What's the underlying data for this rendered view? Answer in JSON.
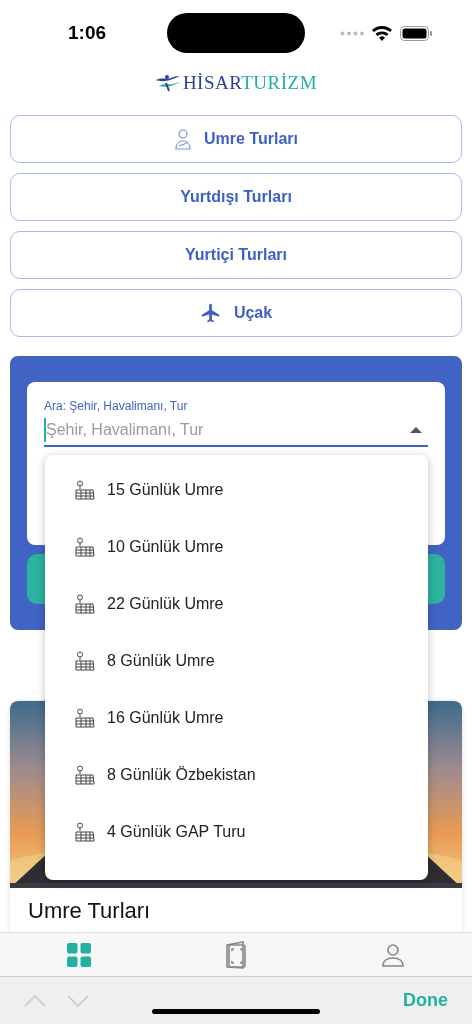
{
  "status_bar": {
    "time": "1:06"
  },
  "logo": {
    "part_1": "HİSAR",
    "part_2": "TURİZM"
  },
  "categories": [
    {
      "label": "Umre Turları",
      "kind": "person"
    },
    {
      "label": "Yurtdışı Turları",
      "kind": "plain"
    },
    {
      "label": "Yurtiçi Turları",
      "kind": "plain"
    },
    {
      "label": "Uçak",
      "kind": "plane"
    }
  ],
  "search": {
    "label": "Ara: Şehir, Havalimanı, Tur",
    "placeholder": "Şehir, Havalimanı, Tur",
    "expanded": true
  },
  "dropdown": [
    {
      "label": "15 Günlük Umre"
    },
    {
      "label": "10 Günlük Umre"
    },
    {
      "label": "22 Günlük Umre"
    },
    {
      "label": "8 Günlük Umre"
    },
    {
      "label": "16 Günlük Umre"
    },
    {
      "label": "8 Günlük Özbekistan"
    },
    {
      "label": "4 Günlük GAP Turu"
    }
  ],
  "tour_card": {
    "kind": "picture",
    "title": "Umre Turları"
  },
  "tab_bar": [
    {
      "kind": "grid",
      "selected": true
    },
    {
      "kind": "passport",
      "selected": false
    },
    {
      "kind": "user",
      "selected": false
    }
  ],
  "keyboard_accessory": {
    "previous_disabled": true,
    "next_disabled": true,
    "done": "Done"
  }
}
